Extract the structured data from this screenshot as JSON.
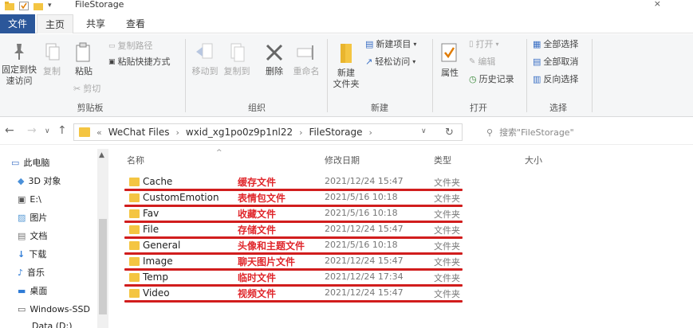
{
  "window": {
    "title": "FileStorage",
    "close": "×"
  },
  "tabs": {
    "file": "文件",
    "home": "主页",
    "share": "共享",
    "view": "查看"
  },
  "ribbon": {
    "clipboard": {
      "pin": "固定到快\n速访问",
      "copy": "复制",
      "paste": "粘贴",
      "copy_path": "复制路径",
      "paste_shortcut": "粘贴快捷方式",
      "cut": "剪切",
      "label": "剪贴板"
    },
    "organize": {
      "move_to": "移动到",
      "copy_to": "复制到",
      "delete": "删除",
      "rename": "重命名",
      "label": "组织"
    },
    "new": {
      "new_folder": "新建\n文件夹",
      "new_item": "新建项目",
      "easy_access": "轻松访问",
      "label": "新建"
    },
    "open": {
      "properties": "属性",
      "open": "打开",
      "edit": "编辑",
      "history": "历史记录",
      "label": "打开"
    },
    "select": {
      "select_all": "全部选择",
      "select_none": "全部取消",
      "invert": "反向选择",
      "label": "选择"
    }
  },
  "address": {
    "prefix": "«",
    "path": [
      "WeChat Files",
      "wxid_xg1po0z9p1nl22",
      "FileStorage"
    ],
    "search_placeholder": "搜索\"FileStorage\""
  },
  "nav": {
    "items": [
      "此电脑",
      "3D 对象",
      "E:\\",
      "图片",
      "文档",
      "下载",
      "音乐",
      "桌面",
      "Windows-SSD",
      "Data (D:)"
    ]
  },
  "columns": {
    "name": "名称",
    "date": "修改日期",
    "type": "类型",
    "size": "大小"
  },
  "files": [
    {
      "name": "Cache",
      "note": "缓存文件",
      "date": "2021/12/24 15:47",
      "type": "文件夹"
    },
    {
      "name": "CustomEmotion",
      "note": "表情包文件",
      "date": "2021/5/16 10:18",
      "type": "文件夹"
    },
    {
      "name": "Fav",
      "note": "收藏文件",
      "date": "2021/5/16 10:18",
      "type": "文件夹"
    },
    {
      "name": "File",
      "note": "存储文件",
      "date": "2021/12/24 15:47",
      "type": "文件夹"
    },
    {
      "name": "General",
      "note": "头像和主题文件",
      "date": "2021/5/16 10:18",
      "type": "文件夹"
    },
    {
      "name": "Image",
      "note": "聊天图片文件",
      "date": "2021/12/24 15:47",
      "type": "文件夹"
    },
    {
      "name": "Temp",
      "note": "临时文件",
      "date": "2021/12/24 17:34",
      "type": "文件夹"
    },
    {
      "name": "Video",
      "note": "视频文件",
      "date": "2021/12/24 15:47",
      "type": "文件夹"
    }
  ],
  "colors": {
    "folder": "#f4c542",
    "annotation": "#e0262b",
    "file_tab": "#2b579a"
  }
}
